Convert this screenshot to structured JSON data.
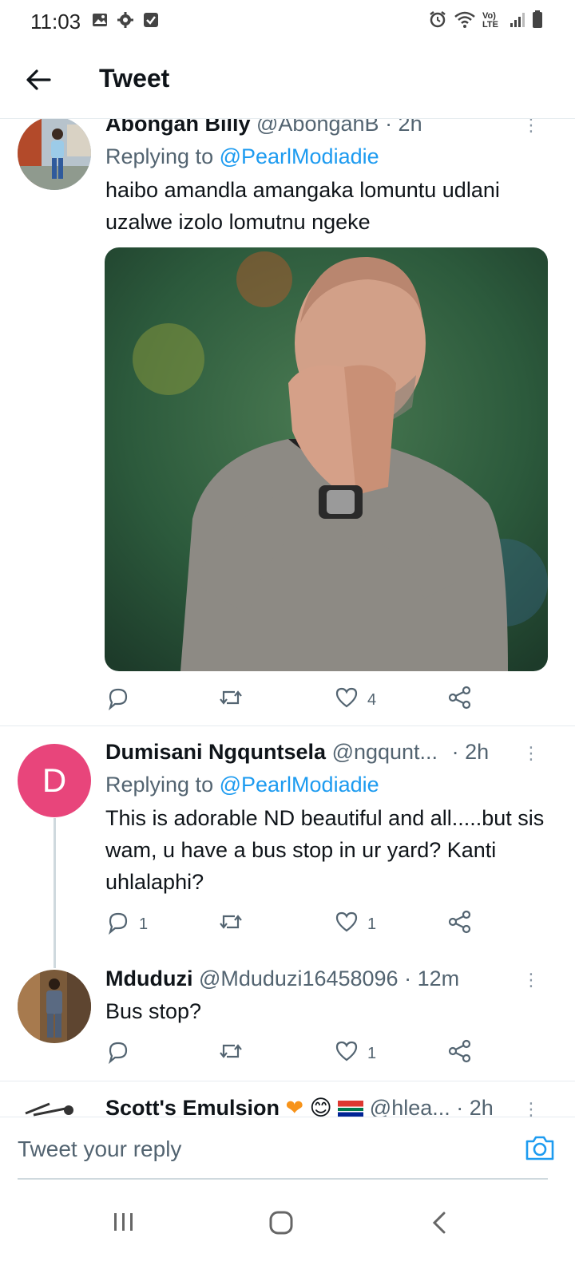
{
  "status_bar": {
    "time": "11:03",
    "network_label": "Vo) LTE"
  },
  "app_bar": {
    "title": "Tweet"
  },
  "tweets": [
    {
      "name": "Abongah Billy",
      "handle": "@AbongahB",
      "time": "· 2h",
      "replying_label": "Replying to",
      "replying_handle": "@PearlModiadie",
      "text": "haibo amandla amangaka lomuntu udlani uzalwe izolo lomutnu ngeke",
      "replies": "",
      "retweets": "",
      "likes": "4"
    },
    {
      "name": "Dumisani Ngquntsela",
      "handle": "@ngqunt...",
      "time": "· 2h",
      "avatar_letter": "D",
      "replying_label": "Replying to",
      "replying_handle": "@PearlModiadie",
      "text": "This is adorable ND beautiful and all.....but sis wam, u have a bus stop in ur yard? Kanti uhlalaphi?",
      "replies": "1",
      "retweets": "",
      "likes": "1"
    },
    {
      "name": "Mduduzi",
      "handle": "@Mduduzi16458096",
      "time": "· 12m",
      "text": "Bus stop?",
      "replies": "",
      "retweets": "",
      "likes": "1"
    },
    {
      "name": "Scott's Emulsion",
      "handle": "@hlea...",
      "time": "· 2h"
    }
  ],
  "composer": {
    "placeholder": "Tweet your reply"
  },
  "colors": {
    "accent": "#1d9bf0",
    "avatar_d": "#e8457b",
    "text": "#0f1419",
    "muted": "#536471"
  },
  "icons": [
    "gallery-icon",
    "settings-icon",
    "check-icon",
    "alarm-icon",
    "wifi-icon",
    "signal-icon",
    "battery-icon",
    "back-arrow-icon",
    "more-icon",
    "reply-icon",
    "retweet-icon",
    "like-icon",
    "share-icon",
    "camera-icon",
    "recent-apps-icon",
    "home-icon",
    "nav-back-icon"
  ]
}
